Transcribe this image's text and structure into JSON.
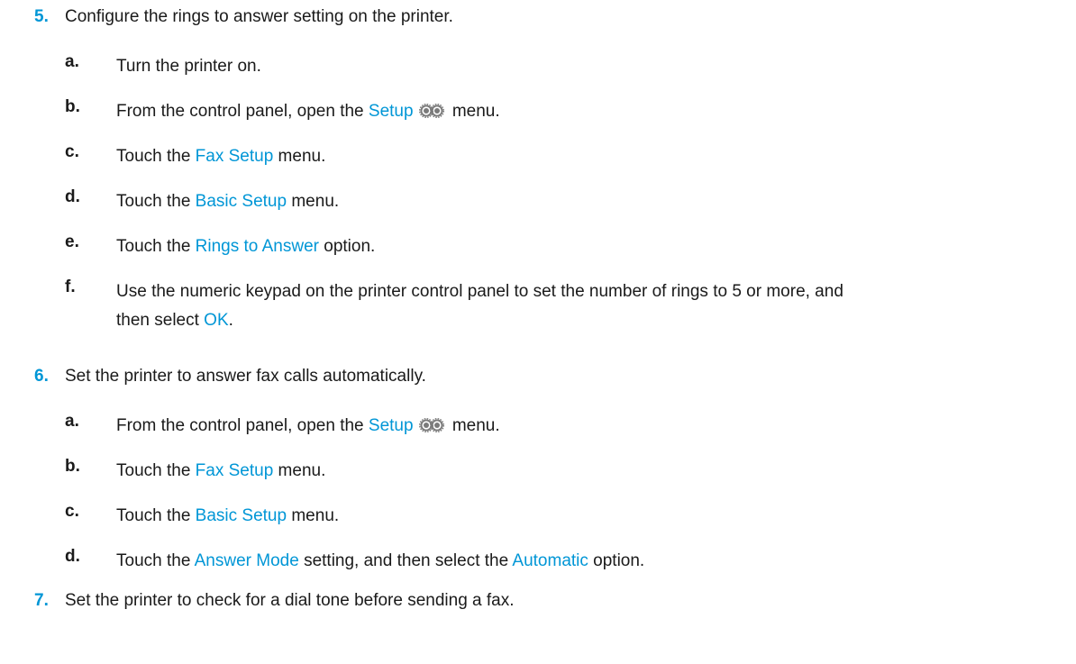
{
  "steps": [
    {
      "num": "5.",
      "text": "Configure the rings to answer setting on the printer.",
      "substeps": [
        {
          "letter": "a.",
          "pre": "Turn the printer on."
        },
        {
          "letter": "b.",
          "pre": "From the control panel, open the ",
          "link": "Setup",
          "icon": "gear-icon",
          "post": " menu."
        },
        {
          "letter": "c.",
          "pre": "Touch the ",
          "link": "Fax Setup",
          "post": " menu."
        },
        {
          "letter": "d.",
          "pre": "Touch the ",
          "link": "Basic Setup",
          "post": " menu."
        },
        {
          "letter": "e.",
          "pre": "Touch the ",
          "link": "Rings to Answer",
          "post": " option."
        },
        {
          "letter": "f.",
          "line1": "Use the numeric keypad on the printer control panel to set the number of rings to 5 or more, and",
          "line2_pre": "then select ",
          "link": "OK",
          "line2_post": "."
        }
      ]
    },
    {
      "num": "6.",
      "text": "Set the printer to answer fax calls automatically.",
      "substeps": [
        {
          "letter": "a.",
          "pre": "From the control panel, open the ",
          "link": "Setup",
          "icon": "gear-icon",
          "post": " menu."
        },
        {
          "letter": "b.",
          "pre": "Touch the ",
          "link": "Fax Setup",
          "post": " menu."
        },
        {
          "letter": "c.",
          "pre": "Touch the ",
          "link": "Basic Setup",
          "post": " menu."
        },
        {
          "letter": "d.",
          "pre": "Touch the ",
          "link": "Answer Mode",
          "mid": " setting, and then select the ",
          "link2": "Automatic",
          "post": " option."
        }
      ]
    },
    {
      "num": "7.",
      "text": "Set the printer to check for a dial tone before sending a fax."
    }
  ],
  "colors": {
    "link": "#0096d6",
    "text": "#1a1a1a",
    "background": "#ffffff"
  }
}
